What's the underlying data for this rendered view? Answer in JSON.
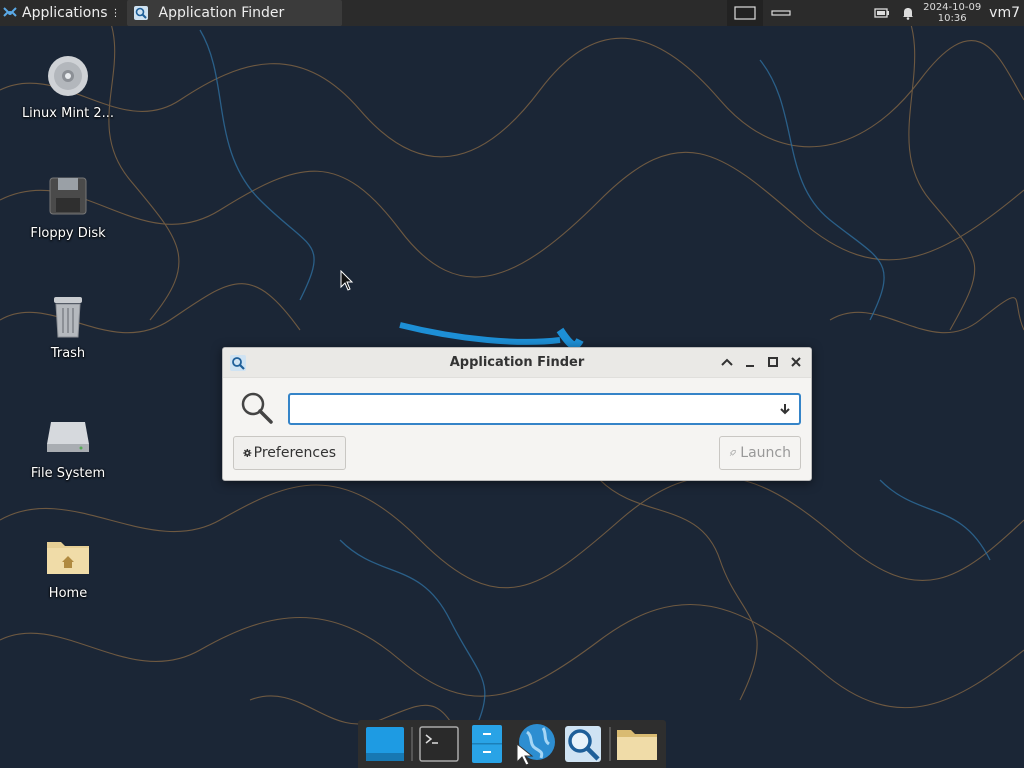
{
  "panel": {
    "applications_label": "Applications",
    "task_label": "Application Finder",
    "clock_date": "2024-10-09",
    "clock_time": "10:36",
    "user": "vm7"
  },
  "desktop": {
    "icons": [
      {
        "label": "Linux Mint 2...",
        "icon": "cd-icon"
      },
      {
        "label": "Floppy Disk",
        "icon": "floppy-icon"
      },
      {
        "label": "Trash",
        "icon": "trash-icon"
      },
      {
        "label": "File System",
        "icon": "drive-icon"
      },
      {
        "label": "Home",
        "icon": "home-folder-icon"
      }
    ]
  },
  "dialog": {
    "title": "Application Finder",
    "search_value": "",
    "preferences_label": "Preferences",
    "launch_label": "Launch"
  },
  "dock": {
    "items": [
      "show-desktop-icon",
      "terminal-icon",
      "file-manager-icon",
      "web-browser-icon",
      "app-finder-icon",
      "folder-icon"
    ]
  },
  "colors": {
    "panel": "#2b2b2b",
    "wallpaper": "#1a2535",
    "accent": "#3584c8"
  }
}
